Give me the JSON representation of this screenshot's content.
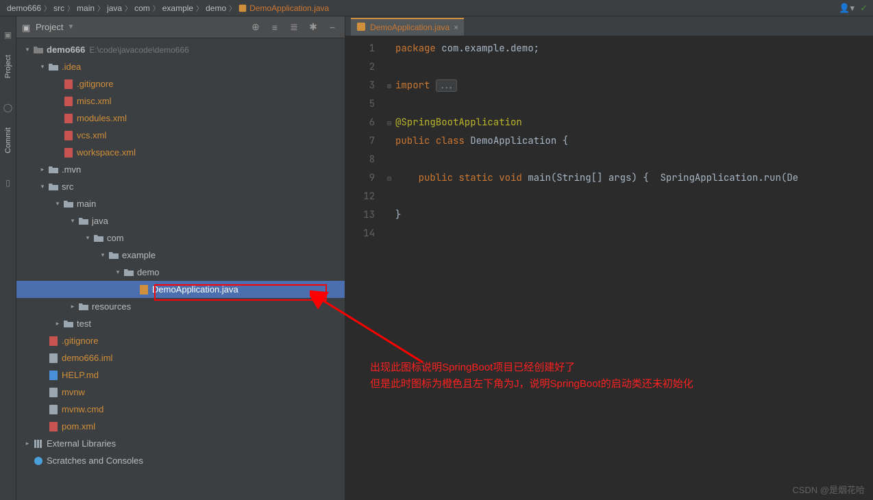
{
  "breadcrumb": [
    "demo666",
    "src",
    "main",
    "java",
    "com",
    "example",
    "demo"
  ],
  "breadcrumb_current": "DemoApplication.java",
  "gutter": {
    "project": "Project",
    "commit": "Commit"
  },
  "panel": {
    "title": "Project"
  },
  "tree": [
    {
      "indent": 0,
      "arrow": "v",
      "icon": "folder-root",
      "label": "demo666",
      "path": "E:\\code\\javacode\\demo666",
      "bold": true
    },
    {
      "indent": 1,
      "arrow": "v",
      "icon": "folder",
      "label": ".idea",
      "orange": true
    },
    {
      "indent": 2,
      "arrow": "",
      "icon": "gitignore",
      "label": ".gitignore",
      "orange": true
    },
    {
      "indent": 2,
      "arrow": "",
      "icon": "xml",
      "label": "misc.xml",
      "orange": true
    },
    {
      "indent": 2,
      "arrow": "",
      "icon": "xml",
      "label": "modules.xml",
      "orange": true
    },
    {
      "indent": 2,
      "arrow": "",
      "icon": "xml",
      "label": "vcs.xml",
      "orange": true
    },
    {
      "indent": 2,
      "arrow": "",
      "icon": "xml",
      "label": "workspace.xml",
      "orange": true
    },
    {
      "indent": 1,
      "arrow": ">",
      "icon": "folder",
      "label": ".mvn"
    },
    {
      "indent": 1,
      "arrow": "v",
      "icon": "folder",
      "label": "src"
    },
    {
      "indent": 2,
      "arrow": "v",
      "icon": "folder",
      "label": "main"
    },
    {
      "indent": 3,
      "arrow": "v",
      "icon": "folder",
      "label": "java"
    },
    {
      "indent": 4,
      "arrow": "v",
      "icon": "folder",
      "label": "com"
    },
    {
      "indent": 5,
      "arrow": "v",
      "icon": "folder",
      "label": "example"
    },
    {
      "indent": 6,
      "arrow": "v",
      "icon": "folder",
      "label": "demo"
    },
    {
      "indent": 7,
      "arrow": "",
      "icon": "java-orange",
      "label": "DemoApplication.java",
      "selected": true
    },
    {
      "indent": 3,
      "arrow": ">",
      "icon": "folder",
      "label": "resources"
    },
    {
      "indent": 2,
      "arrow": ">",
      "icon": "folder",
      "label": "test"
    },
    {
      "indent": 1,
      "arrow": "",
      "icon": "gitignore",
      "label": ".gitignore",
      "orange": true
    },
    {
      "indent": 1,
      "arrow": "",
      "icon": "iml",
      "label": "demo666.iml",
      "orange": true
    },
    {
      "indent": 1,
      "arrow": "",
      "icon": "md",
      "label": "HELP.md",
      "orange": true
    },
    {
      "indent": 1,
      "arrow": "",
      "icon": "file",
      "label": "mvnw",
      "orange": true
    },
    {
      "indent": 1,
      "arrow": "",
      "icon": "file",
      "label": "mvnw.cmd",
      "orange": true
    },
    {
      "indent": 1,
      "arrow": "",
      "icon": "xml",
      "label": "pom.xml",
      "orange": true
    },
    {
      "indent": 0,
      "arrow": ">",
      "icon": "lib",
      "label": "External Libraries"
    },
    {
      "indent": 0,
      "arrow": "",
      "icon": "scratch",
      "label": "Scratches and Consoles"
    }
  ],
  "tab": {
    "label": "DemoApplication.java"
  },
  "line_numbers": [
    "1",
    "2",
    "3",
    "5",
    "6",
    "7",
    "8",
    "9",
    "12",
    "13",
    "14"
  ],
  "code": {
    "l1": {
      "kw": "package",
      "rest": " com.example.demo;"
    },
    "l3": {
      "kw": "import",
      "fold": "..."
    },
    "l6": "@SpringBootApplication",
    "l7_public": "public",
    "l7_class": "class",
    "l7_name": "DemoApplication",
    "l7_brace": " {",
    "l9_public": "public",
    "l9_static": "static",
    "l9_void": "void",
    "l9_rest": " main(String[] args) {  SpringApplication.run(De",
    "l13": "}"
  },
  "overlay": {
    "line1": "出现此图标说明SpringBoot项目已经创建好了",
    "line2": "但是此时图标为橙色且左下角为J，说明SpringBoot的启动类还未初始化"
  },
  "watermark": "CSDN @是烟花哈"
}
